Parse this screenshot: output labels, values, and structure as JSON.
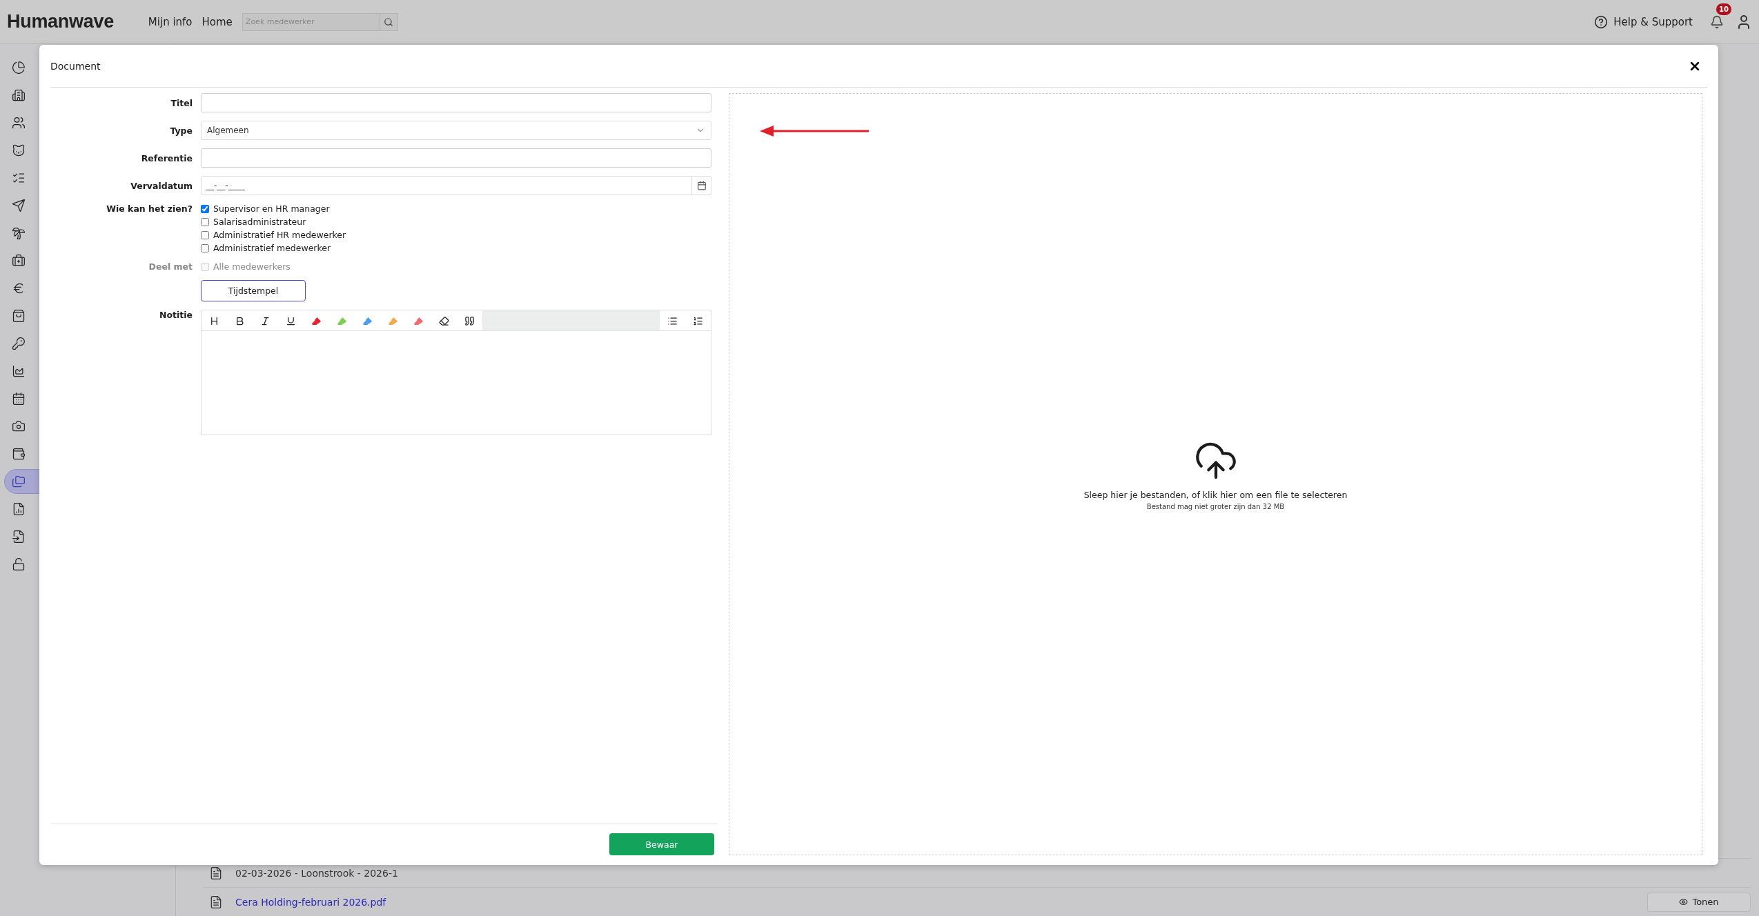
{
  "topbar": {
    "logo": "Humanwave",
    "nav": [
      {
        "label": "Mijn info"
      },
      {
        "label": "Home"
      }
    ],
    "search": {
      "placeholder": "Zoek medewerker"
    },
    "help": "Help & Support",
    "notifications": "10"
  },
  "sidebar": {
    "items": [
      {
        "kind": "pie",
        "selected": false
      },
      {
        "kind": "building",
        "selected": false
      },
      {
        "kind": "users",
        "selected": false
      },
      {
        "kind": "animal",
        "selected": false
      },
      {
        "kind": "checklist",
        "selected": false
      },
      {
        "kind": "send",
        "selected": false
      },
      {
        "kind": "palm",
        "selected": false
      },
      {
        "kind": "medkit",
        "selected": false
      },
      {
        "kind": "euro",
        "selected": false
      },
      {
        "kind": "bag",
        "selected": false
      },
      {
        "kind": "key",
        "selected": false
      },
      {
        "kind": "area",
        "selected": false
      },
      {
        "kind": "calendar",
        "selected": false
      },
      {
        "kind": "camera",
        "selected": false
      },
      {
        "kind": "wallet",
        "selected": false
      },
      {
        "kind": "folders",
        "selected": true
      },
      {
        "kind": "report",
        "selected": false
      },
      {
        "kind": "import",
        "selected": false
      },
      {
        "kind": "unlock",
        "selected": false
      }
    ]
  },
  "background": {
    "rows": [
      {
        "kind": "text",
        "label": "02-03-2026 - Loonstrook - 2026-1"
      },
      {
        "kind": "link",
        "label": "Cera Holding-februari 2026.pdf",
        "button": "Tonen"
      }
    ]
  },
  "modal": {
    "title": "Document",
    "fields": [
      {
        "kind": "text",
        "label": "Titel"
      },
      {
        "kind": "select",
        "label": "Type",
        "value": "Algemeen"
      },
      {
        "kind": "text",
        "label": "Referentie"
      },
      {
        "kind": "date",
        "label": "Vervaldatum",
        "placeholder": "__-__-____"
      }
    ],
    "visibility": {
      "label": "Wie kan het zien?",
      "options": [
        {
          "label": "Supervisor en HR manager",
          "checked": true
        },
        {
          "label": "Salarisadministrateur",
          "checked": false
        },
        {
          "label": "Administratief HR medewerker",
          "checked": false
        },
        {
          "label": "Administratief medewerker",
          "checked": false
        }
      ]
    },
    "share": {
      "label": "Deel met",
      "disabled": true,
      "options": [
        {
          "label": "Alle medewerkers",
          "checked": false
        }
      ]
    },
    "timestamp_button": "Tijdstempel",
    "note": {
      "label": "Notitie",
      "toolbar": [
        {
          "kind": "heading"
        },
        {
          "kind": "bold"
        },
        {
          "kind": "italic"
        },
        {
          "kind": "underline"
        },
        {
          "kind": "marker",
          "color": "#e8202a"
        },
        {
          "kind": "marker",
          "color": "#7ccd4a"
        },
        {
          "kind": "marker",
          "color": "#4a9cf0"
        },
        {
          "kind": "marker",
          "color": "#f5a94a"
        },
        {
          "kind": "marker",
          "color": "#f06a72"
        },
        {
          "kind": "eraser"
        },
        {
          "kind": "quote"
        }
      ],
      "toolbar_right": [
        {
          "kind": "bullets"
        },
        {
          "kind": "numbers"
        }
      ]
    },
    "upload": {
      "text": "Sleep hier je bestanden, of klik hier om een file te selecteren",
      "hint": "Bestand mag niet groter zijn dan 32 MB"
    },
    "save_button": "Bewaar"
  }
}
